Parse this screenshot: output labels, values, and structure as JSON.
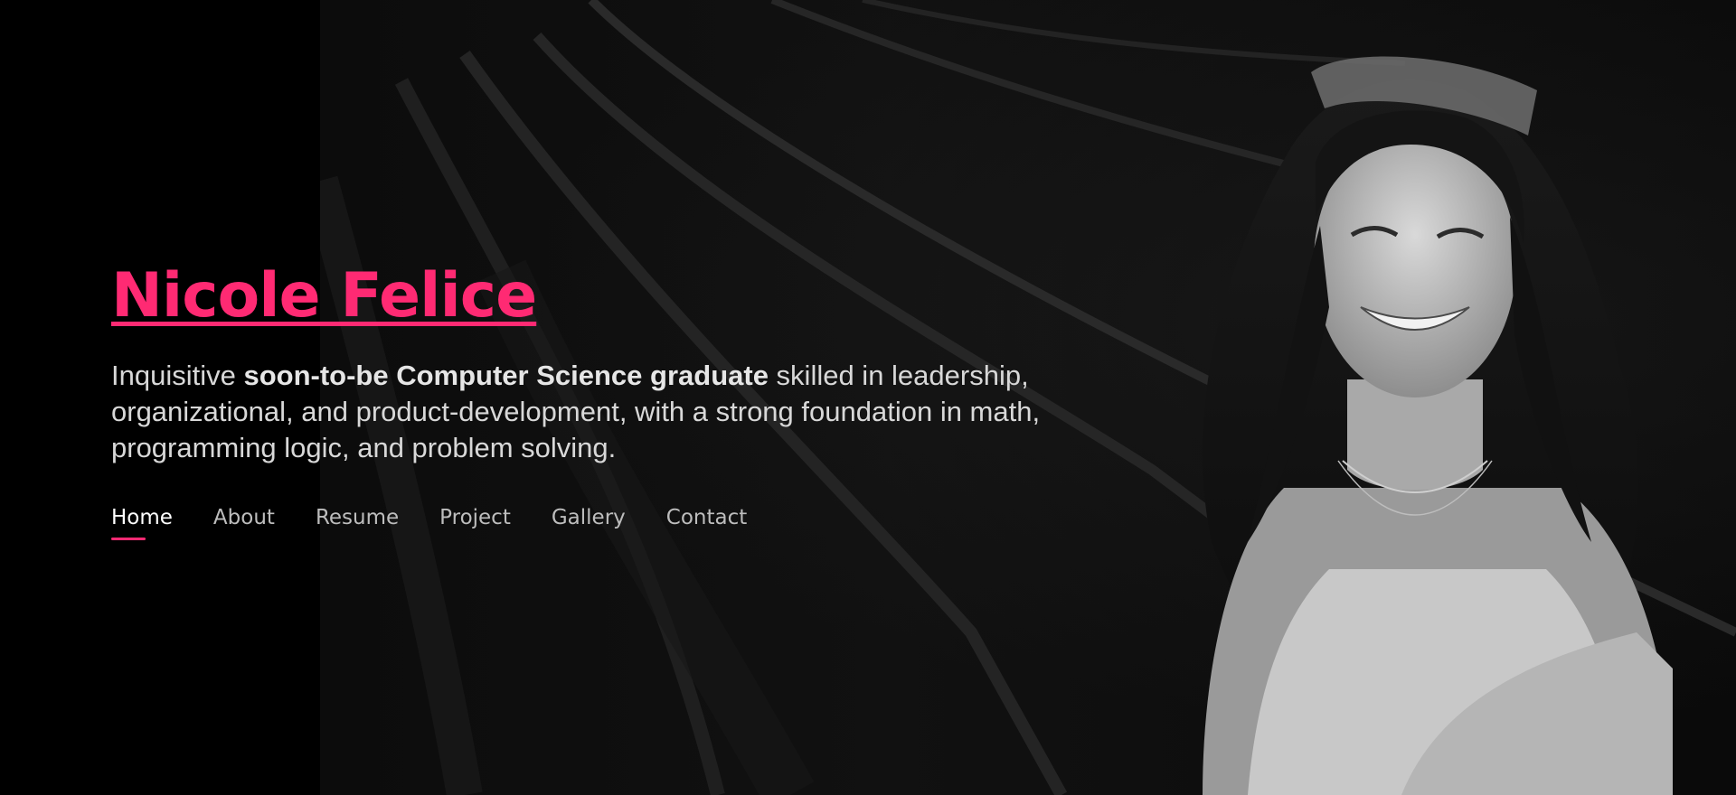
{
  "hero": {
    "name": "Nicole Felice",
    "tagline_pre": "Inquisitive ",
    "tagline_bold": "soon-to-be Computer Science graduate",
    "tagline_post": " skilled in leadership, organizational, and product-development, with a strong foundation in math, programming logic, and problem solving.",
    "accent_color": "#ff2a73"
  },
  "nav": {
    "items": [
      {
        "label": "Home",
        "active": true
      },
      {
        "label": "About",
        "active": false
      },
      {
        "label": "Resume",
        "active": false
      },
      {
        "label": "Project",
        "active": false
      },
      {
        "label": "Gallery",
        "active": false
      },
      {
        "label": "Contact",
        "active": false
      }
    ]
  }
}
